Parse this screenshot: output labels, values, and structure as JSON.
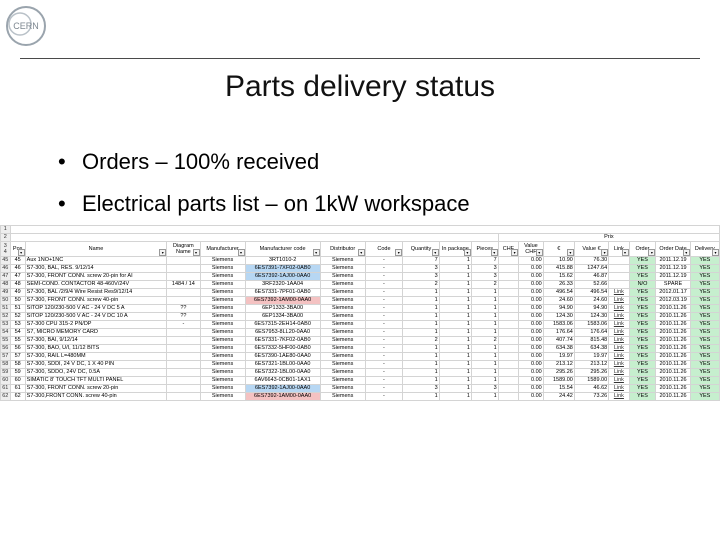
{
  "logo": {
    "text": "CERN",
    "icon": "cern-logo-icon"
  },
  "title": "Parts delivery status",
  "bullets": [
    "Orders – 100% received",
    "Electrical parts list – on 1kW workspace"
  ],
  "sheet": {
    "row_numbers_top": [
      "1",
      "2"
    ],
    "price_group_label": "Prix",
    "header_row_number": "3 4",
    "headers": [
      "Pos",
      "Name",
      "Diagram Name",
      "Manufacturer",
      "Manufacturer code",
      "Distributor",
      "Code",
      "Quantity",
      "In package",
      "Pieces",
      "CHF",
      "Value CHF",
      "€",
      "Value €",
      "Link",
      "Order",
      "Order Date",
      "Delivery"
    ],
    "rows": [
      {
        "rn": "45",
        "pos": "45",
        "name": "Aux 1NO+1NC",
        "diag": "",
        "mfr": "Siemens",
        "code": "3RT1010-2",
        "code_color": "",
        "dist": "Siemens",
        "dcode": "-",
        "qty": "7",
        "pkg": "1",
        "pcs": "7",
        "chf": "",
        "vchf": "0.00",
        "eur": "10.90",
        "veur": "76.30",
        "link": "",
        "order": "YES",
        "date": "2011.12.19",
        "deliv": "YES"
      },
      {
        "rn": "46",
        "pos": "46",
        "name": "S7-300, BAL, RES. 9/12/14",
        "diag": "",
        "mfr": "Siemens",
        "code": "6ES7391-7XF02-0AB0",
        "code_color": "blue",
        "dist": "Siemens",
        "dcode": "-",
        "qty": "3",
        "pkg": "1",
        "pcs": "3",
        "chf": "",
        "vchf": "0.00",
        "eur": "415.88",
        "veur": "1247.64",
        "link": "",
        "order": "YES",
        "date": "2011.12.19",
        "deliv": "YES"
      },
      {
        "rn": "47",
        "pos": "47",
        "name": "S7-300, FRONT CONN. screw 20-pin for AI",
        "diag": "",
        "mfr": "Siemens",
        "code": "6ES7392-1AJ00-0AA0",
        "code_color": "blue",
        "dist": "Siemens",
        "dcode": "-",
        "qty": "3",
        "pkg": "1",
        "pcs": "3",
        "chf": "",
        "vchf": "0.00",
        "eur": "15.62",
        "veur": "46.87",
        "link": "",
        "order": "YES",
        "date": "2011.12.19",
        "deliv": "YES"
      },
      {
        "rn": "48",
        "pos": "48",
        "name": "SEMI-COND. CONTACTOR 48-460V/24V",
        "diag": "1484 / 14",
        "mfr": "Siemens",
        "code": "3RF2320-1AA04",
        "code_color": "",
        "dist": "Siemens",
        "dcode": "-",
        "qty": "2",
        "pkg": "1",
        "pcs": "2",
        "chf": "",
        "vchf": "0.00",
        "eur": "26.33",
        "veur": "52.66",
        "link": "",
        "order": "N/O",
        "date": "SPARE",
        "deliv": "YES"
      },
      {
        "rn": "49",
        "pos": "49",
        "name": "S7-300, BAL /2/9/4 Wire Resist Res9/12/14",
        "diag": "",
        "mfr": "Siemens",
        "code": "6ES7331-7PF01-0AB0",
        "code_color": "",
        "dist": "Siemens",
        "dcode": "-",
        "qty": "1",
        "pkg": "1",
        "pcs": "1",
        "chf": "",
        "vchf": "0.00",
        "eur": "496.54",
        "veur": "496.54",
        "link": "Link",
        "order": "YES",
        "date": "2012.01.17",
        "deliv": "YES"
      },
      {
        "rn": "50",
        "pos": "50",
        "name": "S7-300, FRONT CONN. screw 40-pin",
        "diag": "",
        "mfr": "Siemens",
        "code": "6ES7392-1AM00-0AA0",
        "code_color": "pink",
        "dist": "Siemens",
        "dcode": "-",
        "qty": "1",
        "pkg": "1",
        "pcs": "1",
        "chf": "",
        "vchf": "0.00",
        "eur": "24.60",
        "veur": "24.60",
        "link": "Link",
        "order": "YES",
        "date": "2012.03.19",
        "deliv": "YES"
      },
      {
        "rn": "51",
        "pos": "51",
        "name": "SITOP 120/230-500 V AC - 24 V DC 5 A",
        "diag": "??",
        "mfr": "Siemens",
        "code": "6EP1333-3BA00",
        "code_color": "",
        "dist": "Siemens",
        "dcode": "-",
        "qty": "1",
        "pkg": "1",
        "pcs": "1",
        "chf": "",
        "vchf": "0.00",
        "eur": "94.90",
        "veur": "94.90",
        "link": "Link",
        "order": "YES",
        "date": "2010.11.26",
        "deliv": "YES"
      },
      {
        "rn": "52",
        "pos": "52",
        "name": "SITOP 120/230-500 V AC - 24 V DC 10 A",
        "diag": "??",
        "mfr": "Siemens",
        "code": "6EP1334-3BA00",
        "code_color": "",
        "dist": "Siemens",
        "dcode": "-",
        "qty": "1",
        "pkg": "1",
        "pcs": "1",
        "chf": "",
        "vchf": "0.00",
        "eur": "124.30",
        "veur": "124.30",
        "link": "Link",
        "order": "YES",
        "date": "2010.11.26",
        "deliv": "YES"
      },
      {
        "rn": "53",
        "pos": "53",
        "name": "S7-300 CPU 315-2 PN/DP",
        "diag": "-",
        "mfr": "Siemens",
        "code": "6ES7315-2EH14-0AB0",
        "code_color": "",
        "dist": "Siemens",
        "dcode": "-",
        "qty": "1",
        "pkg": "1",
        "pcs": "1",
        "chf": "",
        "vchf": "0.00",
        "eur": "1583.06",
        "veur": "1583.06",
        "link": "Link",
        "order": "YES",
        "date": "2010.11.26",
        "deliv": "YES"
      },
      {
        "rn": "54",
        "pos": "54",
        "name": "S7, MICRO MEMORY CARD",
        "diag": "",
        "mfr": "Siemens",
        "code": "6ES7953-8LL20-0AA0",
        "code_color": "",
        "dist": "Siemens",
        "dcode": "-",
        "qty": "1",
        "pkg": "1",
        "pcs": "1",
        "chf": "",
        "vchf": "0.00",
        "eur": "176.64",
        "veur": "176.64",
        "link": "Link",
        "order": "YES",
        "date": "2010.11.26",
        "deliv": "YES"
      },
      {
        "rn": "55",
        "pos": "55",
        "name": "S7-300, BAI, 9/12/14",
        "diag": "",
        "mfr": "Siemens",
        "code": "6ES7331-7KF02-0AB0",
        "code_color": "",
        "dist": "Siemens",
        "dcode": "-",
        "qty": "2",
        "pkg": "1",
        "pcs": "2",
        "chf": "",
        "vchf": "0.00",
        "eur": "407.74",
        "veur": "815.48",
        "link": "Link",
        "order": "YES",
        "date": "2010.11.26",
        "deliv": "YES"
      },
      {
        "rn": "56",
        "pos": "56",
        "name": "S7-300, BAO, U/I, 11/12 BITS",
        "diag": "",
        "mfr": "Siemens",
        "code": "6ES7332-5HF00-0AB0",
        "code_color": "",
        "dist": "Siemens",
        "dcode": "-",
        "qty": "1",
        "pkg": "1",
        "pcs": "1",
        "chf": "",
        "vchf": "0.00",
        "eur": "634.38",
        "veur": "634.38",
        "link": "Link",
        "order": "YES",
        "date": "2010.11.26",
        "deliv": "YES"
      },
      {
        "rn": "57",
        "pos": "57",
        "name": "S7-300, RAIL L=480MM",
        "diag": "",
        "mfr": "Siemens",
        "code": "6ES7390-1AE80-0AA0",
        "code_color": "",
        "dist": "Siemens",
        "dcode": "-",
        "qty": "1",
        "pkg": "1",
        "pcs": "1",
        "chf": "",
        "vchf": "0.00",
        "eur": "19.97",
        "veur": "19.97",
        "link": "Link",
        "order": "YES",
        "date": "2010.11.26",
        "deliv": "YES"
      },
      {
        "rn": "58",
        "pos": "58",
        "name": "S7-300, SDDI, 24 V DC, 1 X 40 PIN",
        "diag": "",
        "mfr": "Siemens",
        "code": "6ES7321-1BL00-0AA0",
        "code_color": "",
        "dist": "Siemens",
        "dcode": "-",
        "qty": "1",
        "pkg": "1",
        "pcs": "1",
        "chf": "",
        "vchf": "0.00",
        "eur": "213.12",
        "veur": "213.12",
        "link": "Link",
        "order": "YES",
        "date": "2010.11.26",
        "deliv": "YES"
      },
      {
        "rn": "59",
        "pos": "59",
        "name": "S7-300, SDDO, 24V DC, 0.5A",
        "diag": "",
        "mfr": "Siemens",
        "code": "6ES7322-1BL00-0AA0",
        "code_color": "",
        "dist": "Siemens",
        "dcode": "-",
        "qty": "1",
        "pkg": "1",
        "pcs": "1",
        "chf": "",
        "vchf": "0.00",
        "eur": "295.26",
        "veur": "295.26",
        "link": "Link",
        "order": "YES",
        "date": "2010.11.26",
        "deliv": "YES"
      },
      {
        "rn": "60",
        "pos": "60",
        "name": "SIMATIC 8' TOUCH TFT MULTI PANEL",
        "diag": "",
        "mfr": "Siemens",
        "code": "6AV6643-0CB01-1AX1",
        "code_color": "",
        "dist": "Siemens",
        "dcode": "-",
        "qty": "1",
        "pkg": "1",
        "pcs": "1",
        "chf": "",
        "vchf": "0.00",
        "eur": "1589.00",
        "veur": "1589.00",
        "link": "Link",
        "order": "YES",
        "date": "2010.11.26",
        "deliv": "YES"
      },
      {
        "rn": "61",
        "pos": "61",
        "name": "S7-300, FRONT CONN. screw 20-pin",
        "diag": "",
        "mfr": "Siemens",
        "code": "6ES7392-1AJ00-0AA0",
        "code_color": "blue",
        "dist": "Siemens",
        "dcode": "-",
        "qty": "3",
        "pkg": "1",
        "pcs": "3",
        "chf": "",
        "vchf": "0.00",
        "eur": "15.54",
        "veur": "46.62",
        "link": "Link",
        "order": "YES",
        "date": "2010.11.26",
        "deliv": "YES"
      },
      {
        "rn": "62",
        "pos": "62",
        "name": "S7-300,FRONT CONN. screw 40-pin",
        "diag": "",
        "mfr": "Siemens",
        "code": "6ES7392-1AM00-0AA0",
        "code_color": "pink",
        "dist": "Siemens",
        "dcode": "-",
        "qty": "1",
        "pkg": "1",
        "pcs": "1",
        "chf": "",
        "vchf": "0.00",
        "eur": "24.42",
        "veur": "73.26",
        "link": "Link",
        "order": "YES",
        "date": "2010.11.26",
        "deliv": "YES"
      }
    ]
  },
  "colors": {
    "green": "#c6efce",
    "blue": "#b7d7f3",
    "pink": "#f4c2c2",
    "rule": "#4a4a4a"
  }
}
